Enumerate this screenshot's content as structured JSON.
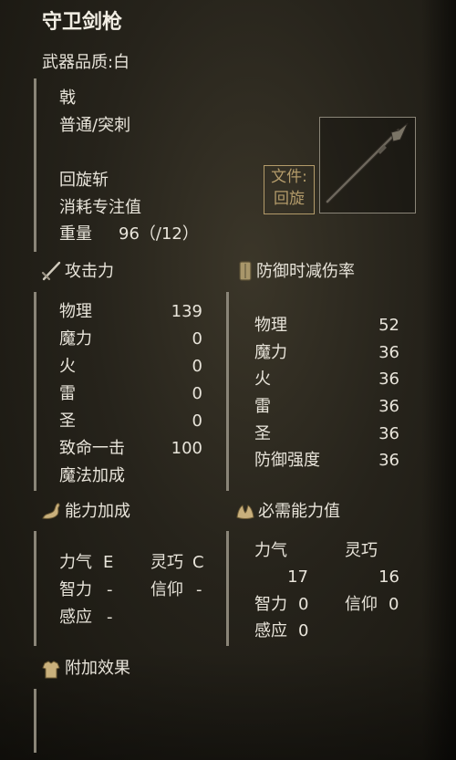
{
  "header": {
    "title": "守卫剑枪",
    "quality": "武器品质:白"
  },
  "weapon_info": {
    "type": "戟",
    "damage_type": "普通/突刺",
    "skill": "回旋斩",
    "cost_label": "消耗专注值",
    "weight_label": "重量",
    "weight_value": "96（/12）"
  },
  "file_tag": {
    "line1": "文件:",
    "line2": "回旋"
  },
  "attack": {
    "title": "攻击力",
    "rows": [
      {
        "label": "物理",
        "value": "139"
      },
      {
        "label": "魔力",
        "value": "0"
      },
      {
        "label": "火",
        "value": "0"
      },
      {
        "label": "雷",
        "value": "0"
      },
      {
        "label": "圣",
        "value": "0"
      },
      {
        "label": "致命一击",
        "value": "100"
      },
      {
        "label": "魔法加成",
        "value": ""
      }
    ]
  },
  "defense": {
    "title": "防御时减伤率",
    "rows": [
      {
        "label": "物理",
        "value": "52"
      },
      {
        "label": "魔力",
        "value": "36"
      },
      {
        "label": "火",
        "value": "36"
      },
      {
        "label": "雷",
        "value": "36"
      },
      {
        "label": "圣",
        "value": "36"
      },
      {
        "label": "防御强度",
        "value": "36"
      }
    ]
  },
  "scaling": {
    "title": "能力加成",
    "str_label": "力气",
    "str_value": "E",
    "dex_label": "灵巧",
    "dex_value": "C",
    "int_label": "智力",
    "int_value": "-",
    "fai_label": "信仰",
    "fai_value": "-",
    "arc_label": "感应",
    "arc_value": "-"
  },
  "requirements": {
    "title": "必需能力值",
    "str_label": "力气",
    "str_value": "17",
    "dex_label": "灵巧",
    "dex_value": "16",
    "int_label": "智力",
    "int_value": "0",
    "fai_label": "信仰",
    "fai_value": "0",
    "arc_label": "感应",
    "arc_value": "0"
  },
  "effects": {
    "title": "附加效果"
  },
  "icons": {
    "attack": "crossed-sword-icon",
    "defense": "shield-icon",
    "scaling": "flexed-arm-icon",
    "requirements": "hands-icon",
    "effects": "armor-icon"
  },
  "colors": {
    "gold": "#b39b6a",
    "text": "#e8e4da",
    "divider": "#8a8578"
  }
}
